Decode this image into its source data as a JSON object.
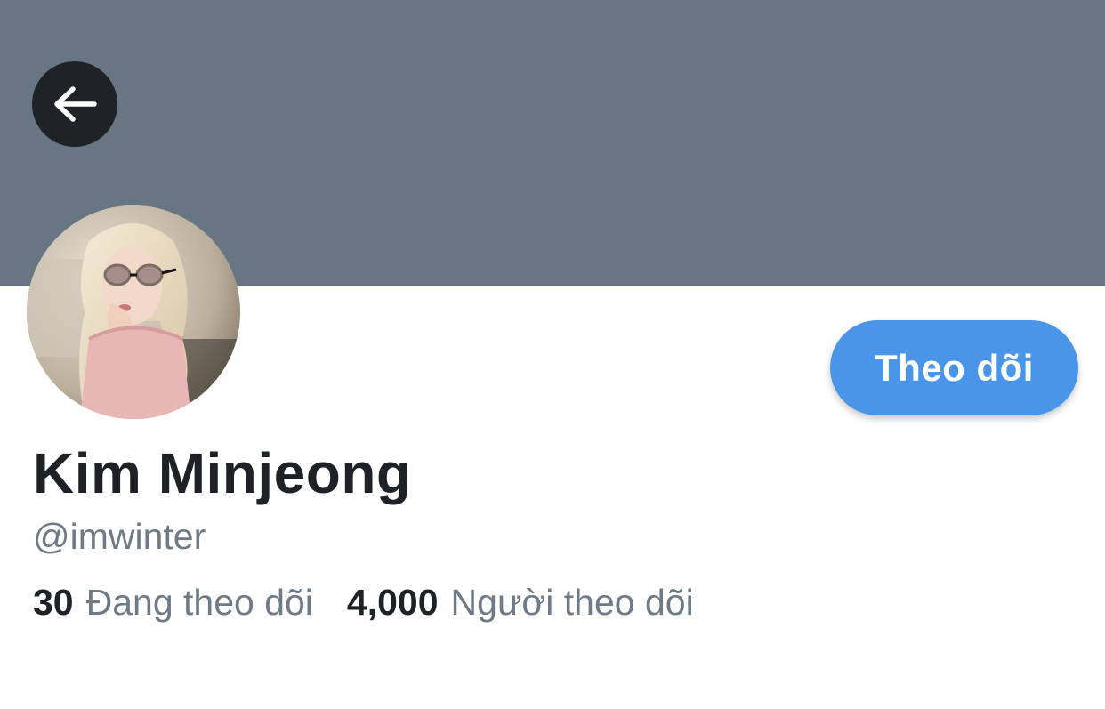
{
  "profile": {
    "display_name": "Kim Minjeong",
    "handle": "@imwinter",
    "follow_label": "Theo dõi",
    "avatar_desc": "profile photo",
    "stats": {
      "following_count": "30",
      "following_label": "Đang theo dõi",
      "followers_count": "4,000",
      "followers_label": "Người theo dõi"
    }
  },
  "icons": {
    "back": "arrow-left-icon"
  },
  "colors": {
    "banner": "#687684",
    "follow_button": "#4a95e8",
    "back_button": "#1f2328",
    "name_text": "#1e2226",
    "secondary_text": "#6e7b87"
  }
}
